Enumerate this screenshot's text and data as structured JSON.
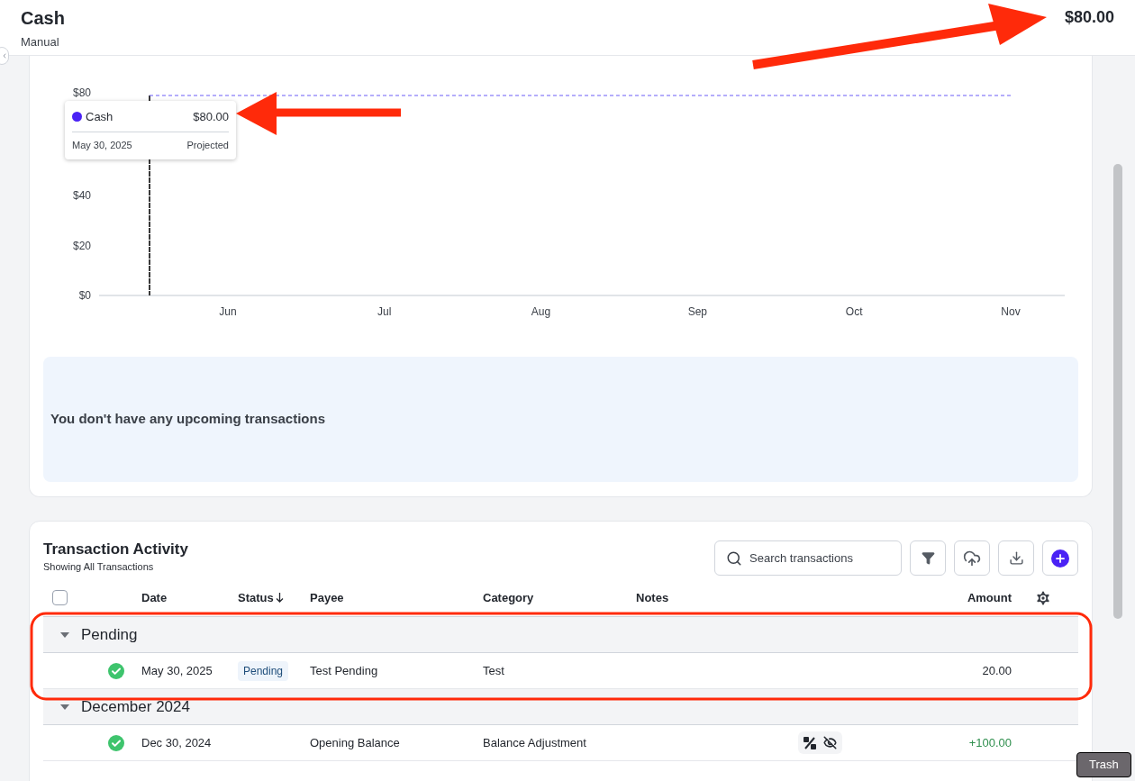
{
  "header": {
    "title": "Cash",
    "subtitle": "Manual",
    "balance": "$80.00"
  },
  "chart": {
    "tooltip": {
      "value": "$80.00",
      "date": "May 30, 2025",
      "status": "Projected",
      "color": "#4a22f5"
    },
    "chart_data": {
      "type": "line",
      "categories": [
        null,
        "Jun",
        null,
        "Jul",
        null,
        "Aug",
        null,
        "Sep",
        null,
        "Oct",
        null,
        "Nov"
      ],
      "ylim": [
        0,
        80
      ],
      "yticks": [
        {
          "value": 0,
          "label": "$0"
        },
        {
          "value": 20,
          "label": "$20"
        },
        {
          "value": 40,
          "label": "$40"
        },
        {
          "value": 80,
          "label": "$80"
        }
      ],
      "series": [
        {
          "name": "Cash",
          "color": "#6b5cf6",
          "line_style": "dashed",
          "values": [
            80,
            80,
            80,
            80,
            80,
            80,
            80,
            80,
            80,
            80,
            80,
            80
          ]
        }
      ]
    }
  },
  "upcoming": {
    "message": "You don't have any upcoming transactions"
  },
  "activity": {
    "select_all": {
      "checked": false
    },
    "title": "Transaction Activity",
    "subtitle": "Showing All Transactions",
    "search": {
      "placeholder": "Search transactions"
    },
    "columns": [
      {
        "label": "Date",
        "sorted": false
      },
      {
        "label": "Status",
        "sorted": true
      },
      {
        "label": "Payee",
        "sorted": false
      },
      {
        "label": "Category",
        "sorted": false
      },
      {
        "label": "Notes",
        "sorted": false
      },
      {
        "label": "Amount",
        "sorted": false
      }
    ],
    "groups": [
      {
        "label": "Pending",
        "expanded": true,
        "rows": [
          {
            "date": "May 30, 2025",
            "status": "Pending",
            "payee": "Test Pending",
            "category": "Test",
            "amount": "20.00",
            "positive": false,
            "flags": false
          }
        ]
      },
      {
        "label": "December 2024",
        "expanded": true,
        "rows": [
          {
            "date": "Dec 30, 2024",
            "payee": "Opening Balance",
            "category": "Balance Adjustment",
            "amount": "+100.00",
            "positive": true,
            "flags": true
          }
        ]
      }
    ]
  },
  "tooltip": "Trash"
}
